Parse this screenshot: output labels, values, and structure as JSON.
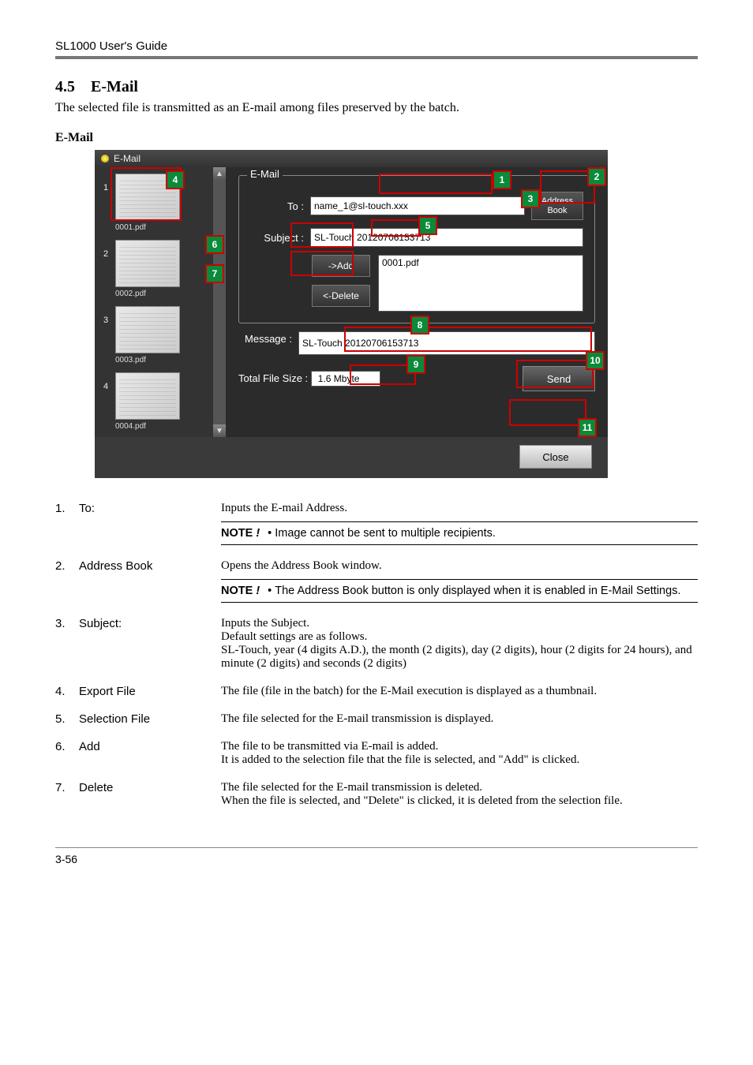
{
  "header": {
    "product": "SL1000 User's Guide"
  },
  "section": {
    "number": "4.5",
    "title": "E-Mail",
    "intro": "The selected file is transmitted as an E-mail among files preserved by the batch.",
    "subhead": "E-Mail"
  },
  "window": {
    "title": "E-Mail",
    "legend": "E-Mail",
    "labels": {
      "to": "To :",
      "subject": "Subject :",
      "message": "Message :",
      "totalFileSize": "Total File Size :"
    },
    "fields": {
      "to": "name_1@sl-touch.xxx",
      "subject": "SL-Touch 20120706153713",
      "message": "SL-Touch 20120706153713",
      "totalFileSize": "1.6 Mbyte"
    },
    "buttons": {
      "addressBook": "Address Book",
      "add": "->Add",
      "delete": "<-Delete",
      "send": "Send",
      "close": "Close"
    },
    "selectionFile": "0001.pdf",
    "thumbs": [
      {
        "idx": "1",
        "label": "0001.pdf"
      },
      {
        "idx": "2",
        "label": "0002.pdf"
      },
      {
        "idx": "3",
        "label": "0003.pdf"
      },
      {
        "idx": "4",
        "label": "0004.pdf"
      }
    ]
  },
  "callouts": [
    "1",
    "2",
    "3",
    "4",
    "5",
    "6",
    "7",
    "8",
    "9",
    "10",
    "11"
  ],
  "definitions": [
    {
      "num": "1.",
      "term": "To:",
      "desc_lines": [
        "Inputs the E-mail Address."
      ],
      "note": [
        "Image cannot be sent to multiple recipients."
      ]
    },
    {
      "num": "2.",
      "term": "Address Book",
      "desc_lines": [
        "Opens the Address Book window."
      ],
      "note": [
        "The Address Book button is only displayed when it is enabled in E-Mail Settings."
      ]
    },
    {
      "num": "3.",
      "term": "Subject:",
      "desc_lines": [
        "Inputs the Subject.",
        "Default settings are as follows.",
        "SL-Touch, year (4 digits A.D.), the month (2 digits), day (2 digits), hour (2 digits for 24 hours), and minute (2 digits) and seconds (2 digits)"
      ]
    },
    {
      "num": "4.",
      "term": "Export File",
      "desc_lines": [
        "The file (file in the batch) for the E-Mail execution is displayed as a thumbnail."
      ]
    },
    {
      "num": "5.",
      "term": "Selection File",
      "desc_lines": [
        "The file selected for the E-mail transmission is displayed."
      ]
    },
    {
      "num": "6.",
      "term": "Add",
      "desc_lines": [
        "The file to be transmitted via E-mail is added.",
        "It is added to the selection file that the file is selected, and \"Add\" is clicked."
      ]
    },
    {
      "num": "7.",
      "term": "Delete",
      "desc_lines": [
        "The file selected for the E-mail transmission is deleted.",
        "When the file is selected, and \"Delete\" is clicked, it is deleted from the selection file."
      ]
    }
  ],
  "note_label_prefix": "NOTE",
  "note_label_excl": "!",
  "footer": {
    "page": "3-56"
  }
}
